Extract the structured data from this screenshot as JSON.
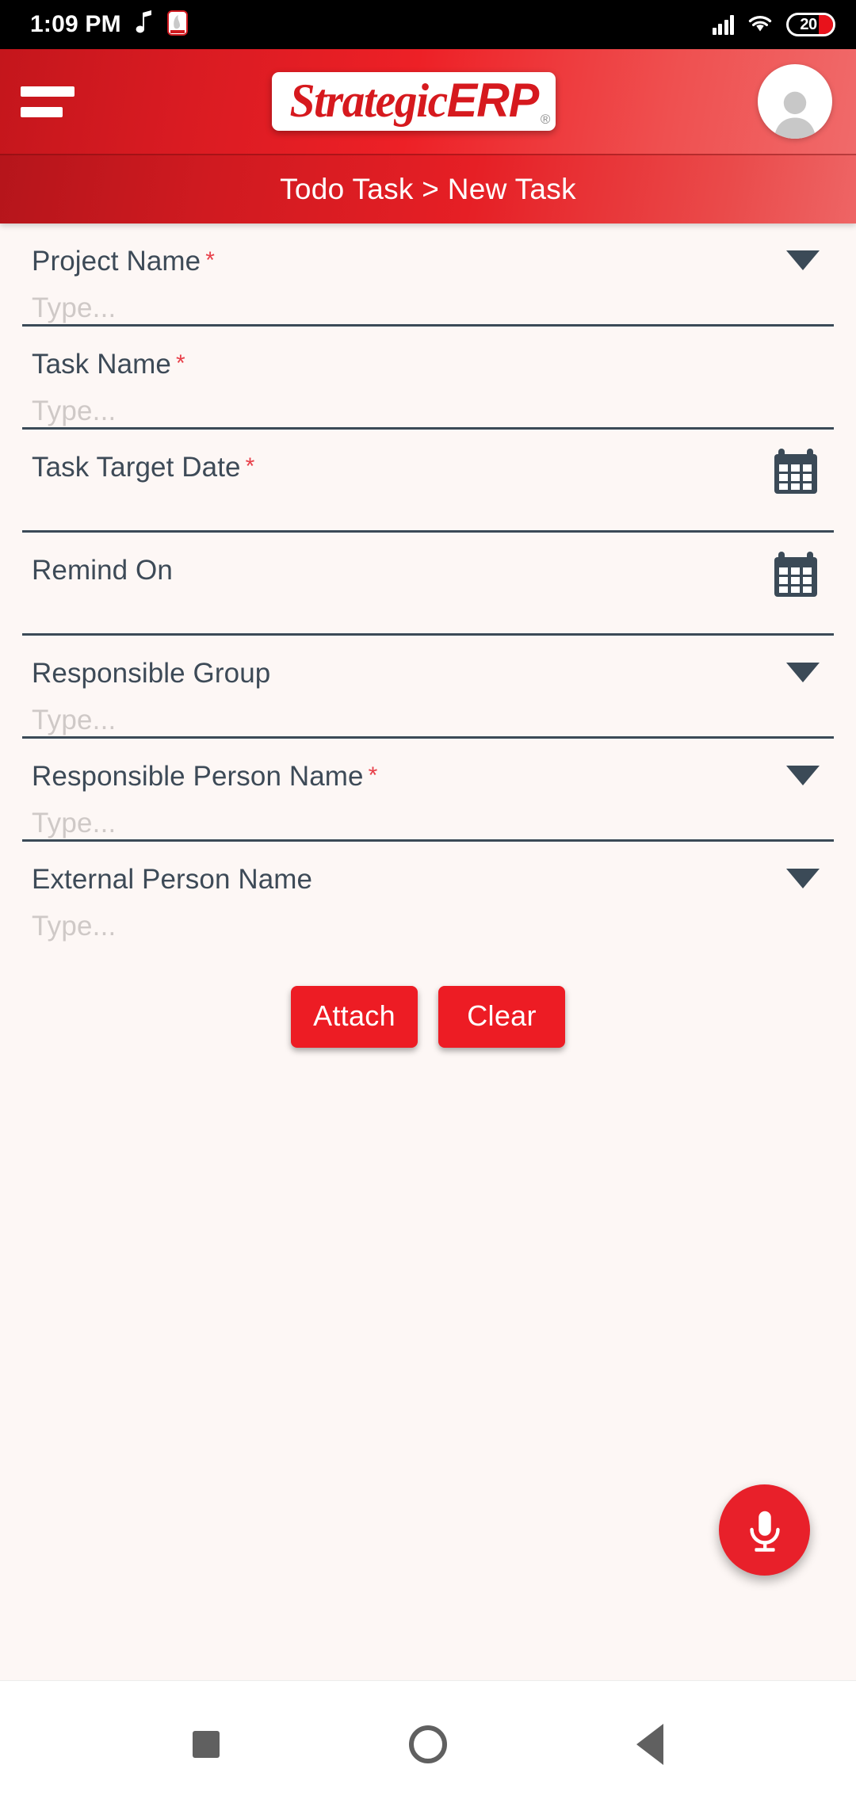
{
  "status_bar": {
    "time": "1:09 PM",
    "icons": [
      "music-note-icon",
      "app-notification-icon",
      "signal-icon",
      "wifi-icon"
    ],
    "battery_level": "20"
  },
  "header": {
    "menu_icon": "hamburger-menu-icon",
    "logo_strategic": "Strategic",
    "logo_erp": "ERP",
    "logo_registered": "®",
    "avatar_icon": "user-avatar-icon"
  },
  "breadcrumb": {
    "text": "Todo Task > New Task"
  },
  "form": {
    "fields": [
      {
        "label": "Project Name",
        "required": "*",
        "placeholder": "Type...",
        "control": "dropdown",
        "icon": "chevron-down-icon"
      },
      {
        "label": "Task Name",
        "required": "*",
        "placeholder": "Type...",
        "control": "text",
        "icon": ""
      },
      {
        "label": "Task Target Date",
        "required": "*",
        "placeholder": "",
        "control": "date",
        "icon": "calendar-icon"
      },
      {
        "label": "Remind On",
        "required": "",
        "placeholder": "",
        "control": "date",
        "icon": "calendar-icon"
      },
      {
        "label": "Responsible Group",
        "required": "",
        "placeholder": "Type...",
        "control": "dropdown",
        "icon": "chevron-down-icon"
      },
      {
        "label": "Responsible Person Name",
        "required": "*",
        "placeholder": "Type...",
        "control": "dropdown",
        "icon": "chevron-down-icon"
      },
      {
        "label": "External Person Name",
        "required": "",
        "placeholder": "Type...",
        "control": "dropdown",
        "icon": "chevron-down-icon"
      }
    ],
    "buttons": {
      "attach": "Attach",
      "clear": "Clear"
    }
  },
  "fab": {
    "icon": "microphone-icon"
  },
  "bottom_nav": {
    "recents_icon": "square-recents-icon",
    "home_icon": "circle-home-icon",
    "back_icon": "triangle-back-icon"
  },
  "colors": {
    "brand_red": "#ed1c24",
    "header_dark_red": "#c4161c",
    "label_slate": "#3d4a57",
    "required_red": "#e8404a",
    "page_bg": "#fdf7f5",
    "placeholder_gray": "#cfc9c7"
  }
}
